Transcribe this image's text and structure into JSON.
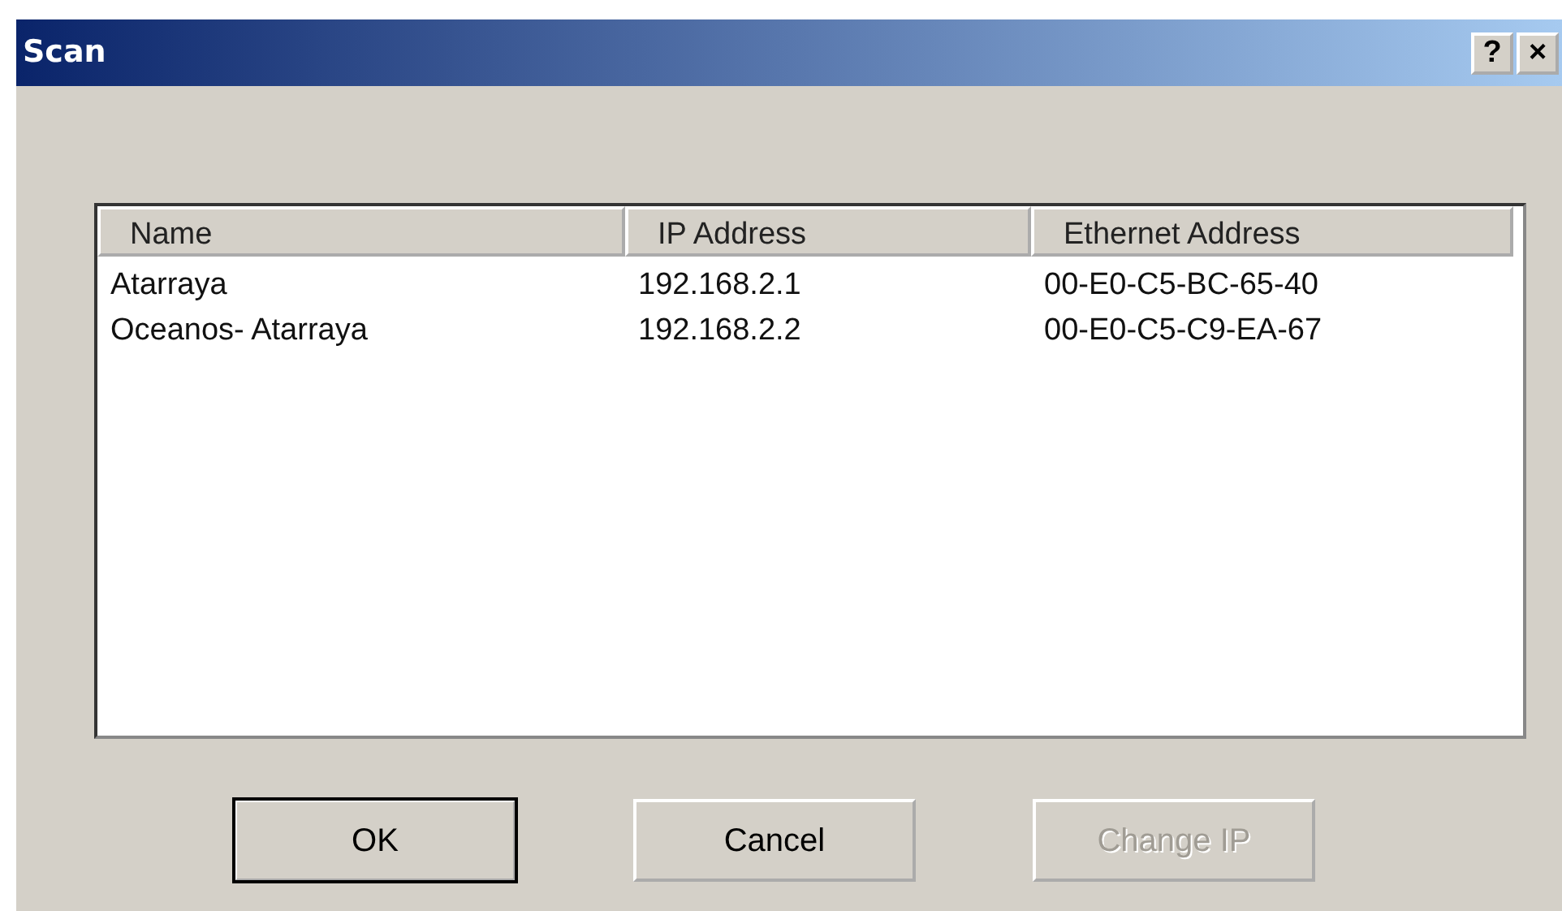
{
  "window": {
    "title": "Scan",
    "help_button": "?",
    "close_button": "×"
  },
  "table": {
    "columns": [
      "Name",
      "IP Address",
      "Ethernet Address"
    ],
    "rows": [
      {
        "cells": [
          "Atarraya",
          "192.168.2.1",
          "00-E0-C5-BC-65-40"
        ]
      },
      {
        "cells": [
          "Oceanos- Atarraya",
          "192.168.2.2",
          "00-E0-C5-C9-EA-67"
        ]
      }
    ]
  },
  "buttons": [
    {
      "label": "OK",
      "default": true,
      "disabled": false
    },
    {
      "label": "Cancel",
      "default": false,
      "disabled": false
    },
    {
      "label": "Change IP",
      "default": false,
      "disabled": true
    }
  ]
}
